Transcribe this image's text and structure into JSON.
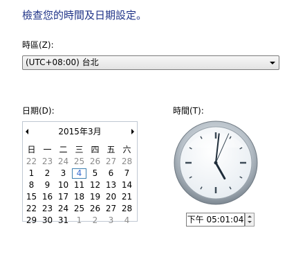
{
  "heading": "檢查您的時間及日期設定。",
  "timezone": {
    "label": "時區(Z):",
    "value": "(UTC+08:00) 台北"
  },
  "date": {
    "label": "日期(D):",
    "month_title": "2015年3月",
    "weekdays": [
      "日",
      "一",
      "二",
      "三",
      "四",
      "五",
      "六"
    ],
    "days": [
      {
        "d": "22",
        "other": true
      },
      {
        "d": "23",
        "other": true
      },
      {
        "d": "24",
        "other": true
      },
      {
        "d": "25",
        "other": true
      },
      {
        "d": "26",
        "other": true
      },
      {
        "d": "27",
        "other": true
      },
      {
        "d": "28",
        "other": true
      },
      {
        "d": "1"
      },
      {
        "d": "2"
      },
      {
        "d": "3"
      },
      {
        "d": "4",
        "today": true
      },
      {
        "d": "5"
      },
      {
        "d": "6"
      },
      {
        "d": "7"
      },
      {
        "d": "8"
      },
      {
        "d": "9"
      },
      {
        "d": "10"
      },
      {
        "d": "11"
      },
      {
        "d": "12"
      },
      {
        "d": "13"
      },
      {
        "d": "14"
      },
      {
        "d": "15"
      },
      {
        "d": "16"
      },
      {
        "d": "17"
      },
      {
        "d": "18"
      },
      {
        "d": "19"
      },
      {
        "d": "20"
      },
      {
        "d": "21"
      },
      {
        "d": "22"
      },
      {
        "d": "23"
      },
      {
        "d": "24"
      },
      {
        "d": "25"
      },
      {
        "d": "26"
      },
      {
        "d": "27"
      },
      {
        "d": "28"
      },
      {
        "d": "29"
      },
      {
        "d": "30"
      },
      {
        "d": "31"
      },
      {
        "d": "1",
        "other": true
      },
      {
        "d": "2",
        "other": true
      },
      {
        "d": "3",
        "other": true
      },
      {
        "d": "4",
        "other": true
      }
    ]
  },
  "time": {
    "label": "時間(T):",
    "value": "下午 05:01:04",
    "clock": {
      "hour": 5,
      "minute": 1,
      "second": 4
    }
  }
}
